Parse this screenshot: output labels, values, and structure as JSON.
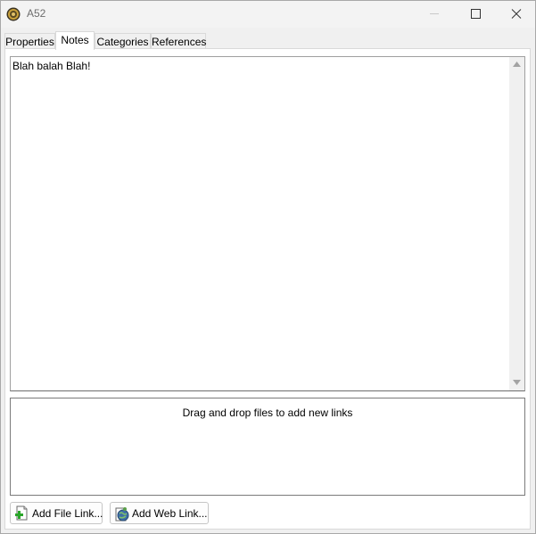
{
  "window": {
    "title": "A52",
    "app_icon": "gear-icon",
    "controls": {
      "minimize": "minimize-icon",
      "maximize": "maximize-icon",
      "close": "close-icon"
    }
  },
  "tabs": [
    {
      "label": "Properties",
      "active": false
    },
    {
      "label": "Notes",
      "active": true
    },
    {
      "label": "Categories",
      "active": false
    },
    {
      "label": "References",
      "active": false
    }
  ],
  "notes": {
    "text": "Blah balah Blah!"
  },
  "links": {
    "drop_hint": "Drag and drop files to add new links"
  },
  "buttons": {
    "add_file_link": "Add File Link...",
    "add_web_link": "Add Web Link..."
  },
  "colors": {
    "window_bg": "#f0f0f0",
    "panel_bg": "#ffffff",
    "plus_green": "#2aa52a"
  }
}
